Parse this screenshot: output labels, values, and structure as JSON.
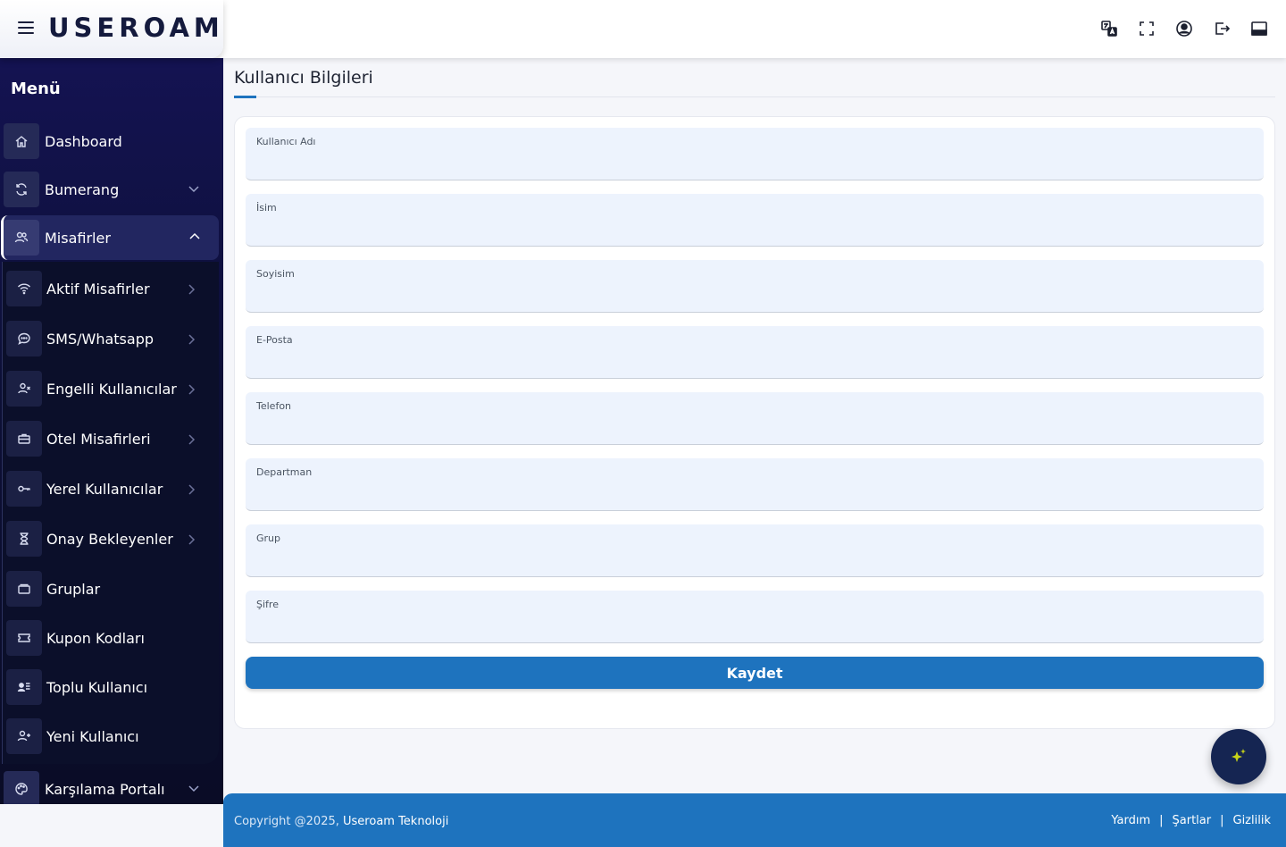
{
  "header": {
    "logo_text": "USEROAM",
    "icons": [
      "translate-icon",
      "fullscreen-icon",
      "user-account-icon",
      "logout-icon",
      "panel-layout-icon"
    ]
  },
  "sidebar": {
    "menu_title": "Menü",
    "items": [
      {
        "label": "Dashboard",
        "icon": "home-icon"
      },
      {
        "label": "Bumerang",
        "icon": "refresh-icon"
      },
      {
        "label": "Misafirler",
        "icon": "users-icon"
      }
    ],
    "sub_items": [
      {
        "label": "Aktif Misafirler",
        "icon": "wifi-icon"
      },
      {
        "label": "SMS/Whatsapp",
        "icon": "message-icon"
      },
      {
        "label": "Engelli Kullanıcılar",
        "icon": "user-block-icon"
      },
      {
        "label": "Otel Misafirleri",
        "icon": "briefcase-icon"
      },
      {
        "label": "Yerel Kullanıcılar",
        "icon": "key-icon"
      },
      {
        "label": "Onay Bekleyenler",
        "icon": "hourglass-icon"
      },
      {
        "label": "Gruplar",
        "icon": "folder-icon"
      },
      {
        "label": "Kupon Kodları",
        "icon": "ticket-icon"
      },
      {
        "label": "Toplu Kullanıcı",
        "icon": "user-list-icon"
      },
      {
        "label": "Yeni Kullanıcı",
        "icon": "user-add-icon"
      }
    ],
    "bottom_item": {
      "label": "Karşılama Portalı",
      "icon": "palette-icon"
    }
  },
  "main": {
    "page_title": "Kullanıcı Bilgileri",
    "fields": [
      {
        "label": "Kullanıcı Adı",
        "value": ""
      },
      {
        "label": "İsim",
        "value": ""
      },
      {
        "label": "Soyisim",
        "value": ""
      },
      {
        "label": "E-Posta",
        "value": ""
      },
      {
        "label": "Telefon",
        "value": ""
      },
      {
        "label": "Departman",
        "value": ""
      },
      {
        "label": "Grup",
        "value": ""
      },
      {
        "label": "Şifre",
        "value": ""
      }
    ],
    "save_label": "Kaydet"
  },
  "footer": {
    "copyright_prefix": "Copyright @2025,",
    "company": "Useroam Teknoloji",
    "links": [
      "Yardım",
      "Şartlar",
      "Gizlilik"
    ],
    "separator": "|"
  },
  "colors": {
    "primary": "#1e73be",
    "sidebar_bg": "#0c0f35",
    "field_bg": "#edf3fd",
    "accent": "#c7d318"
  }
}
